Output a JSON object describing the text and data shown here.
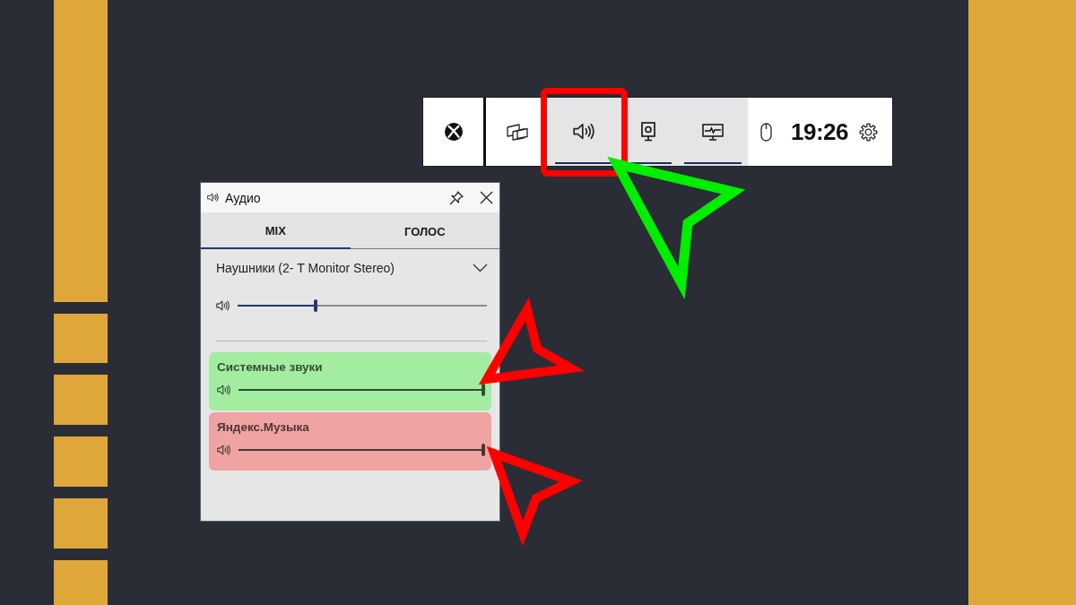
{
  "game_bar": {
    "widgets": [
      {
        "kind": "xbox",
        "on": false
      },
      {
        "kind": "gallery",
        "on": false
      },
      {
        "kind": "audio",
        "on": true
      },
      {
        "kind": "capture",
        "on": true
      },
      {
        "kind": "performance",
        "on": true
      }
    ],
    "clock": "19:26"
  },
  "audio_window": {
    "title": "Аудио",
    "tabs": [
      {
        "label": "MIX",
        "selected": true
      },
      {
        "label": "ГОЛОС",
        "selected": false
      }
    ],
    "device": {
      "value": "Наушники (2- T Monitor Stereo)"
    },
    "master_volume": {
      "level": 0.31
    },
    "apps": [
      {
        "name": "Системные звуки",
        "color": "#a3eda0",
        "level": 1
      },
      {
        "name": "Яндекс.Музыка",
        "color": "#f0a3a3",
        "level": 1
      }
    ]
  }
}
